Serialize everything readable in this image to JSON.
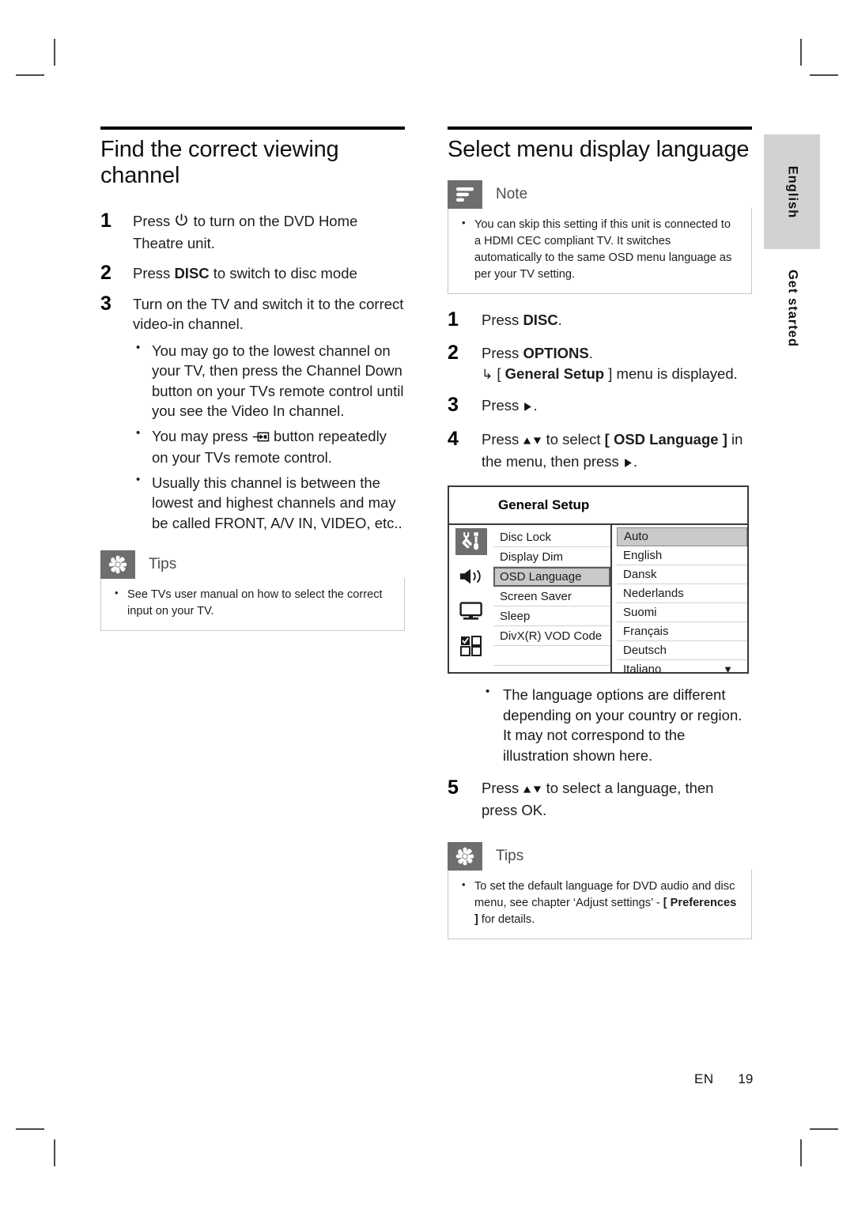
{
  "page": {
    "footer_locale": "EN",
    "footer_page": "19",
    "side_tab_language": "English",
    "side_tab_chapter": "Get started"
  },
  "left_column": {
    "title": "Find the correct viewing channel",
    "steps": [
      {
        "num": "1",
        "text_before": "Press",
        "icon": "power-icon",
        "text_after": "to turn on the DVD Home Theatre unit."
      },
      {
        "num": "2",
        "text_before": "Press",
        "bold": "DISC",
        "text_after": "to switch to disc mode"
      },
      {
        "num": "3",
        "text": "Turn on the TV and switch it to the correct video-in channel.",
        "bullets": [
          {
            "text": "You may go to the lowest channel on your TV, then press the Channel Down button on your TVs remote control until you see the Video In channel."
          },
          {
            "text_before": "You may press",
            "icon": "source-input-icon",
            "text_after": "button repeatedly on your TVs remote control."
          },
          {
            "text": "Usually this channel is between the lowest and highest channels and may be called FRONT, A/V IN, VIDEO, etc.."
          }
        ]
      }
    ],
    "tips": {
      "icon": "tips-asterisk-icon",
      "label": "Tips",
      "items": [
        "See TVs user manual on how to select the correct input on your TV."
      ]
    }
  },
  "right_column": {
    "title": "Select menu display language",
    "note": {
      "icon": "note-lines-icon",
      "label": "Note",
      "items": [
        "You can skip this setting if this unit is connected to a HDMI CEC compliant TV.  It switches automatically to the same OSD menu language as per your TV setting."
      ]
    },
    "steps": [
      {
        "num": "1",
        "text_before": "Press",
        "bold": "DISC",
        "text_after": "."
      },
      {
        "num": "2",
        "text_before": "Press",
        "bold": "OPTIONS",
        "text_after": ".",
        "result_hook": "↳",
        "result_open": "[",
        "result_bold": "General Setup",
        "result_close": "]",
        "result_tail": "menu is displayed."
      },
      {
        "num": "3",
        "text_before": "Press",
        "icon": "right-arrow-icon",
        "text_after": "."
      },
      {
        "num": "4",
        "text_before": "Press",
        "icon": "up-down-arrows-icon",
        "text_mid": "to select",
        "bracket_open": "[",
        "bold": "OSD Language",
        "bracket_close": "]",
        "text_after": "in the menu, then press",
        "icon2": "right-arrow-icon",
        "text_end": "."
      },
      {
        "num": "5",
        "text_before": "Press",
        "icon": "up-down-arrows-icon",
        "text_after": "to select a language, then press",
        "bold": "OK",
        "text_end": "."
      }
    ],
    "osd": {
      "title": "General Setup",
      "icons": [
        {
          "name": "tools-icon",
          "selected": true
        },
        {
          "name": "speaker-icon",
          "selected": false
        },
        {
          "name": "monitor-icon",
          "selected": false
        },
        {
          "name": "preferences-grid-icon",
          "selected": false
        }
      ],
      "menu_items": [
        {
          "label": "Disc Lock",
          "selected": false
        },
        {
          "label": "Display Dim",
          "selected": false
        },
        {
          "label": "OSD Language",
          "selected": true
        },
        {
          "label": "Screen Saver",
          "selected": false
        },
        {
          "label": "Sleep",
          "selected": false
        },
        {
          "label": "DivX(R) VOD Code",
          "selected": false
        },
        {
          "label": "",
          "selected": false
        }
      ],
      "options": [
        {
          "label": "Auto",
          "selected": true
        },
        {
          "label": "English",
          "selected": false
        },
        {
          "label": "Dansk",
          "selected": false
        },
        {
          "label": "Nederlands",
          "selected": false
        },
        {
          "label": "Suomi",
          "selected": false
        },
        {
          "label": "Français",
          "selected": false
        },
        {
          "label": "Deutsch",
          "selected": false
        },
        {
          "label": "Italiano",
          "selected": false,
          "more_caret": "▼"
        }
      ]
    },
    "after_osd_bullets": [
      "The language options are different depending on your country or region. It may not correspond to the illustration shown here."
    ],
    "tips": {
      "icon": "tips-asterisk-icon",
      "label": "Tips",
      "items": [
        {
          "part1": "To set the default language for DVD audio and disc menu, see chapter ‘Adjust settings’ - ",
          "bold": "[ Preferences ]",
          "part2": " for details."
        }
      ]
    }
  }
}
